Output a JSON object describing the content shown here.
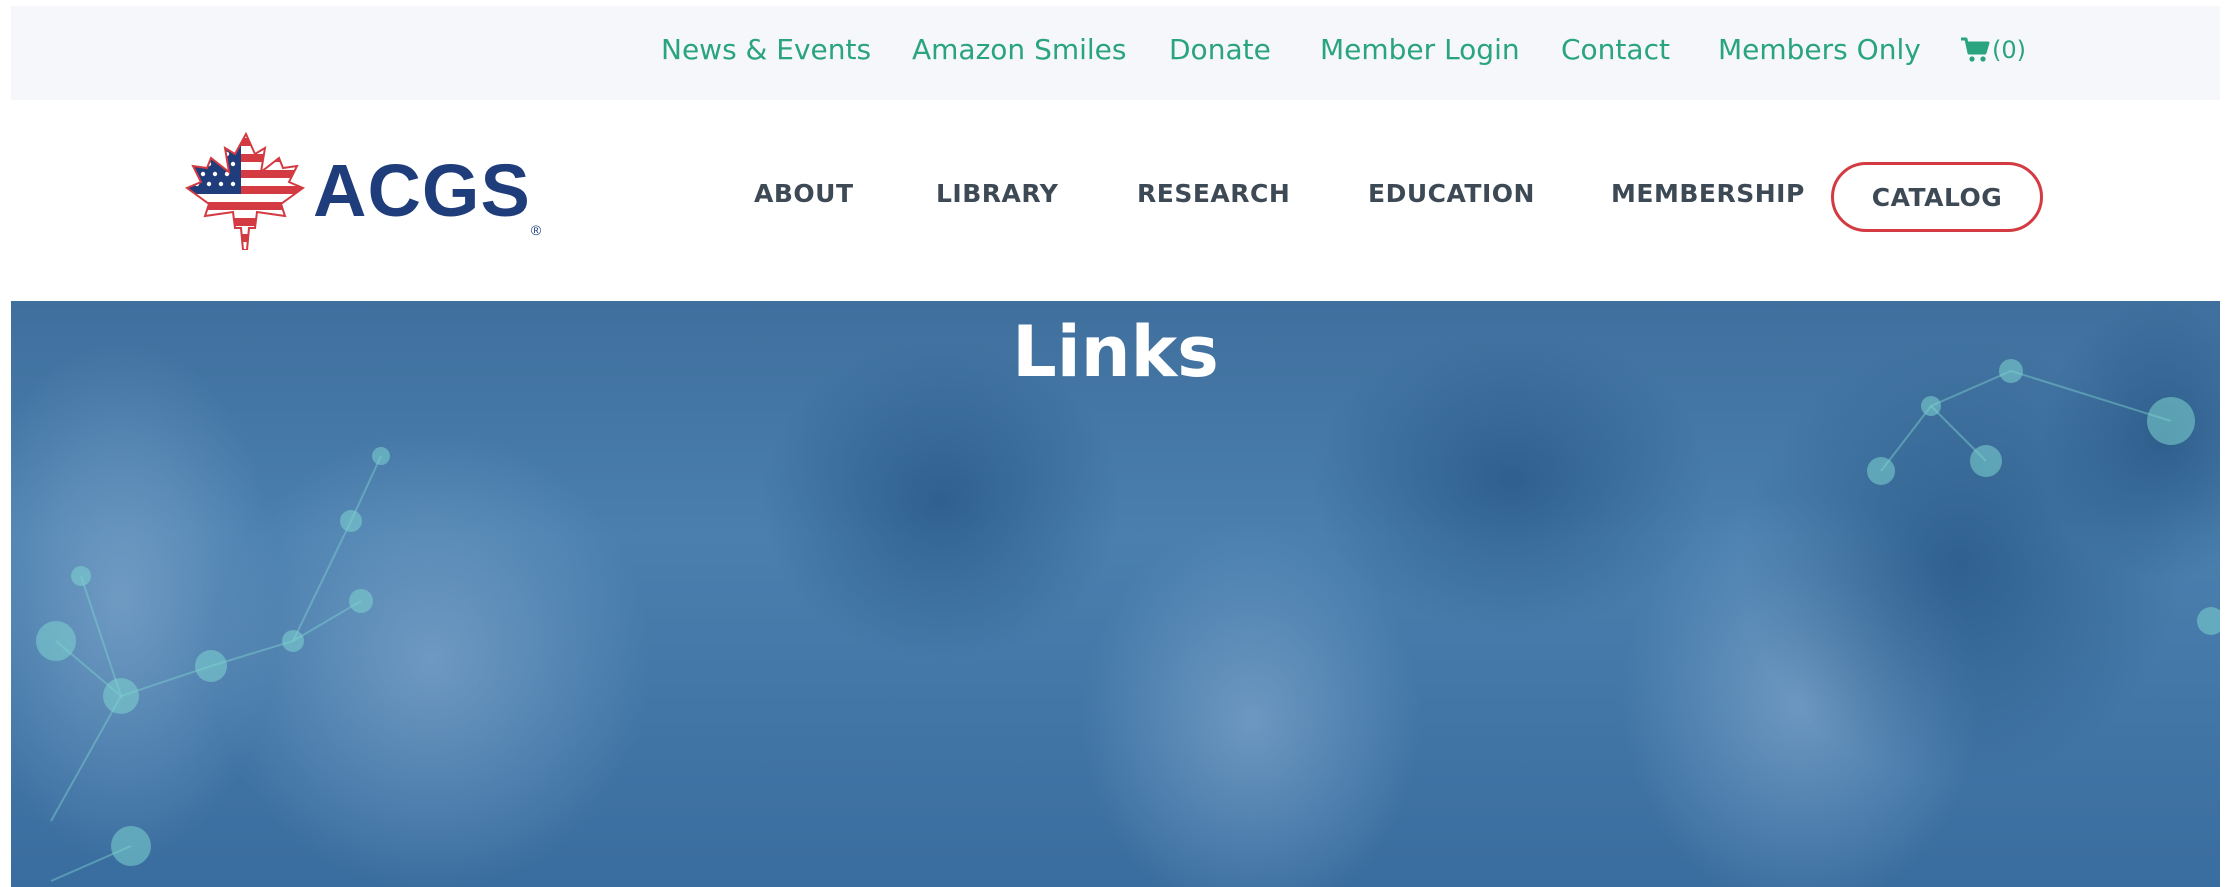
{
  "utility_nav": {
    "items": [
      {
        "label": "News & Events"
      },
      {
        "label": "Amazon Smiles"
      },
      {
        "label": "Donate"
      },
      {
        "label": "Member Login"
      },
      {
        "label": "Contact"
      },
      {
        "label": "Members Only"
      }
    ],
    "cart": {
      "icon": "shopping-cart-icon",
      "count": "(0)"
    }
  },
  "header": {
    "logo_text": "ACGS",
    "logo_reg": "®",
    "nav": [
      {
        "label": "ABOUT"
      },
      {
        "label": "LIBRARY"
      },
      {
        "label": "RESEARCH"
      },
      {
        "label": "EDUCATION"
      },
      {
        "label": "MEMBERSHIP"
      }
    ],
    "catalog_label": "CATALOG"
  },
  "hero": {
    "title": "Links"
  },
  "colors": {
    "accent_green": "#2aa47e",
    "brand_blue": "#1f3d7a",
    "catalog_border": "#d33a42",
    "hero_overlay": "#3f6f9d"
  }
}
